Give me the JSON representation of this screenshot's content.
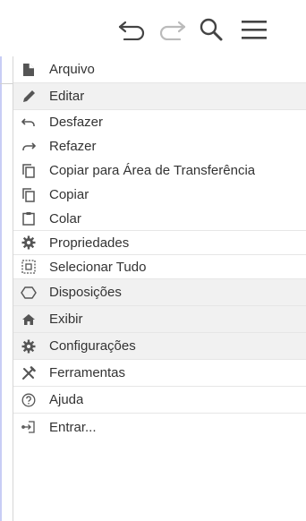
{
  "colors": {
    "icon": "#555555",
    "toolbar_icon": "#444444",
    "text": "#333333",
    "highlight": "#f1f1f1",
    "separator": "#e6e6e6",
    "frame": "#c8cdf5"
  },
  "toolbar": {
    "undo_icon": "undo-icon",
    "redo_icon": "redo-icon",
    "search_icon": "search-icon",
    "menu_icon": "hamburger-menu-icon"
  },
  "menu": {
    "items": [
      {
        "label": "Arquivo",
        "icon": "file-icon"
      },
      {
        "label": "Editar",
        "icon": "pencil-icon"
      },
      {
        "label": "Desfazer",
        "icon": "undo-icon"
      },
      {
        "label": "Refazer",
        "icon": "redo-icon"
      },
      {
        "label": "Copiar para Área de Transferência",
        "icon": "copy-icon"
      },
      {
        "label": "Copiar",
        "icon": "copy-icon"
      },
      {
        "label": "Colar",
        "icon": "clipboard-icon"
      },
      {
        "label": "Propriedades",
        "icon": "gear-icon"
      },
      {
        "label": "Selecionar Tudo",
        "icon": "select-all-icon"
      },
      {
        "label": "Disposições",
        "icon": "layout-icon"
      },
      {
        "label": "Exibir",
        "icon": "home-icon"
      },
      {
        "label": "Configurações",
        "icon": "settings-icon"
      },
      {
        "label": "Ferramentas",
        "icon": "tools-icon"
      },
      {
        "label": "Ajuda",
        "icon": "help-icon"
      },
      {
        "label": "Entrar...",
        "icon": "sign-in-icon"
      }
    ]
  }
}
